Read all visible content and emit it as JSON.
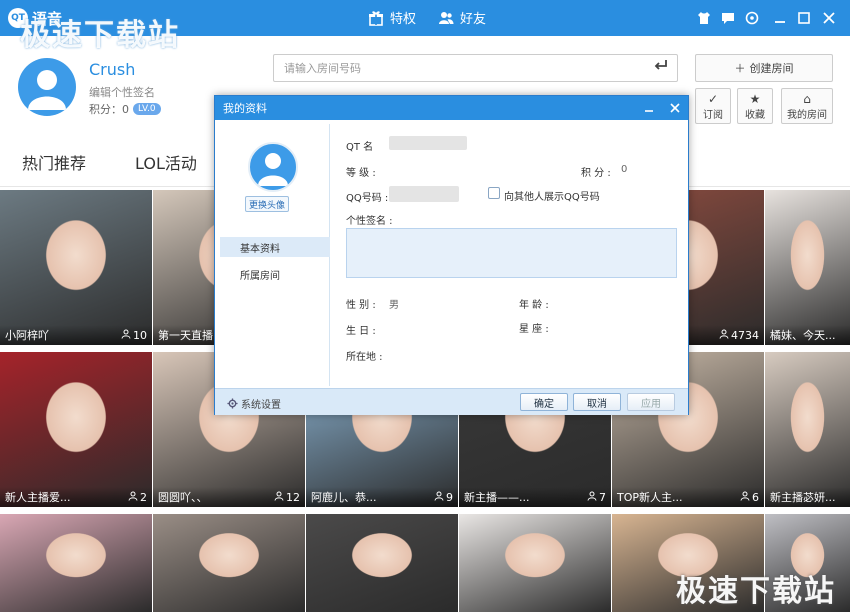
{
  "window": {
    "app_title": "语音",
    "logo_text": "QT",
    "watermark": "极速下载站"
  },
  "top_nav": {
    "privilege": "特权",
    "friends": "好友"
  },
  "profile": {
    "username": "Crush",
    "signature": "编辑个性签名",
    "points_label": "积分：0",
    "level": "LV.0"
  },
  "search": {
    "placeholder": "请输入房间号码"
  },
  "actions": {
    "create_room": "创建房间",
    "subscribe": "订阅",
    "favorites": "收藏",
    "my_rooms": "我的房间"
  },
  "tabs": [
    "热门推荐",
    "LOL活动"
  ],
  "tiles": [
    {
      "name": "小阿梓吖",
      "count": "10",
      "color": "#6c7a82"
    },
    {
      "name": "第一天直播...",
      "count": "",
      "color": "#d4c7ba"
    },
    {
      "name": "",
      "count": "",
      "color": "#c0b0a8"
    },
    {
      "name": "",
      "count": "",
      "color": "#bfa79a"
    },
    {
      "name": "",
      "count": "4734",
      "color": "#8a4b3f"
    },
    {
      "name": "橘妹、今天...",
      "count": "",
      "color": "#e7e2de"
    },
    {
      "name": "新人主播爱...",
      "count": "2",
      "color": "#a5232a"
    },
    {
      "name": "圆圆吖、、",
      "count": "12",
      "color": "#d8c6b8"
    },
    {
      "name": "阿鹿儿、恭...",
      "count": "9",
      "color": "#8fb8d8"
    },
    {
      "name": "新主播——...",
      "count": "7",
      "color": "#3a3a3a"
    },
    {
      "name": "TOP新人主...",
      "count": "6",
      "color": "#c7b7a6"
    },
    {
      "name": "新主播苾妍...",
      "count": "",
      "color": "#d7cbc0"
    },
    {
      "name": "",
      "count": "",
      "color": "#d9a7b4"
    },
    {
      "name": "",
      "count": "",
      "color": "#9a8e86"
    },
    {
      "name": "",
      "count": "",
      "color": "#4b4a4a"
    },
    {
      "name": "",
      "count": "",
      "color": "#e9e6e4"
    },
    {
      "name": "",
      "count": "",
      "color": "#d8b592"
    },
    {
      "name": "",
      "count": "",
      "color": "#bfbfc4"
    }
  ],
  "dialog": {
    "title": "我的资料",
    "change_avatar": "更换头像",
    "nav": [
      "基本资料",
      "所属房间"
    ],
    "fields": {
      "qt_name": "QT 名",
      "level": "等 级 :",
      "points": "积 分 :",
      "points_value": "0",
      "qq_number": "QQ号码 :",
      "show_qq": "向其他人展示QQ号码",
      "signature": "个性签名 :",
      "gender": "性 别 :",
      "gender_value": "男",
      "age": "年 龄 :",
      "birthday": "生 日 :",
      "zodiac": "星 座 :",
      "location": "所在地 :"
    },
    "footer": {
      "settings": "系统设置",
      "ok": "确定",
      "cancel": "取消",
      "apply": "应用"
    }
  },
  "colors": {
    "brand": "#2a8ee0",
    "level_badge": "#6aa8ec"
  }
}
